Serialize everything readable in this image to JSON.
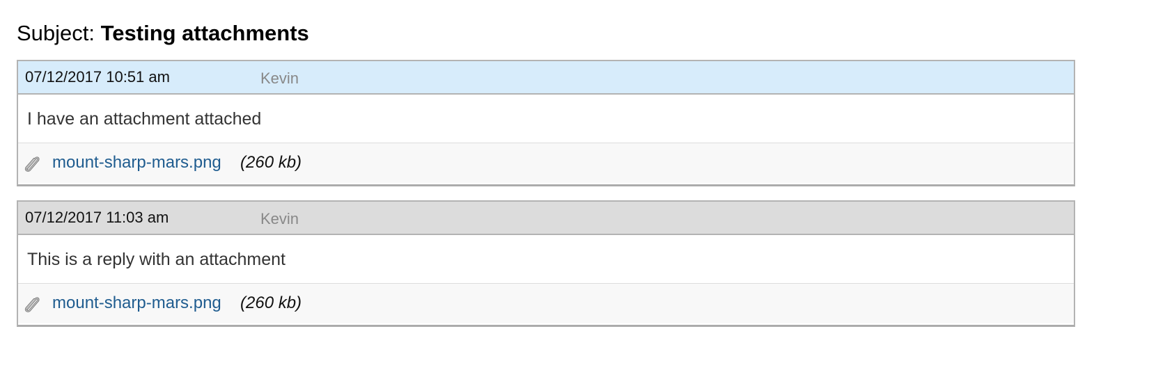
{
  "subject": {
    "label": "Subject:",
    "value": "Testing attachments"
  },
  "entries": [
    {
      "date": "07/12/2017 10:51 am",
      "author": "Kevin",
      "message": "I have an attachment attached",
      "attachment": {
        "icon": "paperclip-icon",
        "filename": "mount-sharp-mars.png",
        "size": "(260 kb)"
      },
      "header_color": "#d7ecfb"
    },
    {
      "date": "07/12/2017 11:03 am",
      "author": "Kevin",
      "message": "This is a reply with an attachment",
      "attachment": {
        "icon": "paperclip-icon",
        "filename": "mount-sharp-mars.png",
        "size": "(260 kb)"
      },
      "header_color": "#dcdcdc"
    }
  ],
  "colors": {
    "link": "#1f5c8f",
    "author": "#888888",
    "border": "#b3b3b3"
  }
}
